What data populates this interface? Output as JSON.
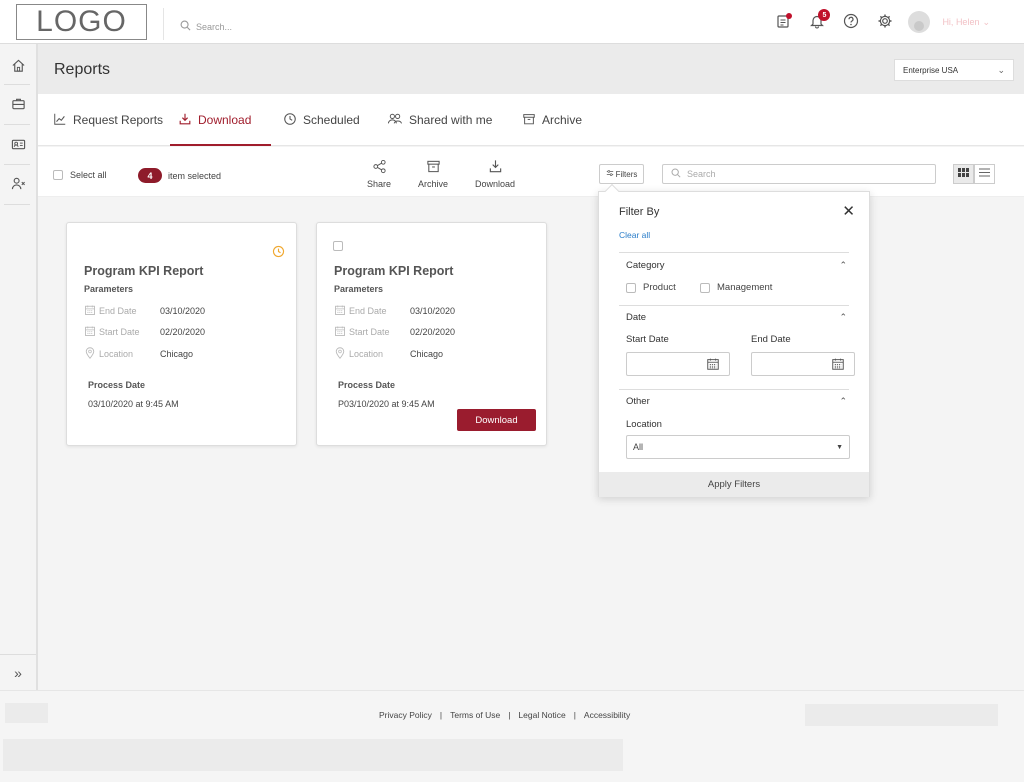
{
  "header": {
    "logo_text": "LOGO",
    "search_placeholder": "Search...",
    "notification_count": "5",
    "user_greeting": "Hi, Helen"
  },
  "page": {
    "title": "Reports",
    "org_selector": "Enterprise USA"
  },
  "tabs": [
    {
      "label": "Request Reports",
      "icon": "chart-line-icon"
    },
    {
      "label": "Download",
      "icon": "download-tray-icon",
      "active": true
    },
    {
      "label": "Scheduled",
      "icon": "clock-icon"
    },
    {
      "label": "Shared with me",
      "icon": "users-icon"
    },
    {
      "label": "Archive",
      "icon": "archive-icon"
    }
  ],
  "toolbar": {
    "select_all": "Select all",
    "selected_count": "4",
    "selected_text": "item selected",
    "actions": [
      {
        "label": "Share",
        "icon": "share-icon"
      },
      {
        "label": "Archive",
        "icon": "archive-icon"
      },
      {
        "label": "Download",
        "icon": "download-icon"
      }
    ],
    "filters_label": "Filters",
    "search_placeholder": "Search"
  },
  "cards": [
    {
      "title": "Program KPI Report",
      "params_label": "Parameters",
      "params": [
        {
          "label": "End Date",
          "value": "03/10/2020"
        },
        {
          "label": "Start Date",
          "value": "02/20/2020"
        },
        {
          "label": "Location",
          "value": "Chicago"
        }
      ],
      "process_label": "Process Date",
      "process_value": "03/10/2020 at 9:45 AM"
    },
    {
      "title": "Program KPI Report",
      "params_label": "Parameters",
      "params": [
        {
          "label": "End Date",
          "value": "03/10/2020"
        },
        {
          "label": "Start Date",
          "value": "02/20/2020"
        },
        {
          "label": "Location",
          "value": "Chicago"
        }
      ],
      "process_label": "Process Date",
      "process_value": "P03/10/2020 at 9:45 AM",
      "button": "Download"
    }
  ],
  "filter_panel": {
    "title": "Filter By",
    "clear_all": "Clear all",
    "category_label": "Category",
    "category_options": [
      "Product",
      "Management"
    ],
    "date_label": "Date",
    "start_date_label": "Start Date",
    "end_date_label": "End Date",
    "other_label": "Other",
    "location_label": "Location",
    "location_value": "All",
    "apply_label": "Apply Filters"
  },
  "footer": {
    "links": [
      "Privacy Policy",
      "Terms of Use",
      "Legal Notice",
      "Accessibility"
    ]
  },
  "colors": {
    "brand": "#9a1c2e",
    "link": "#2a7dc9",
    "warning": "#f0a830"
  }
}
